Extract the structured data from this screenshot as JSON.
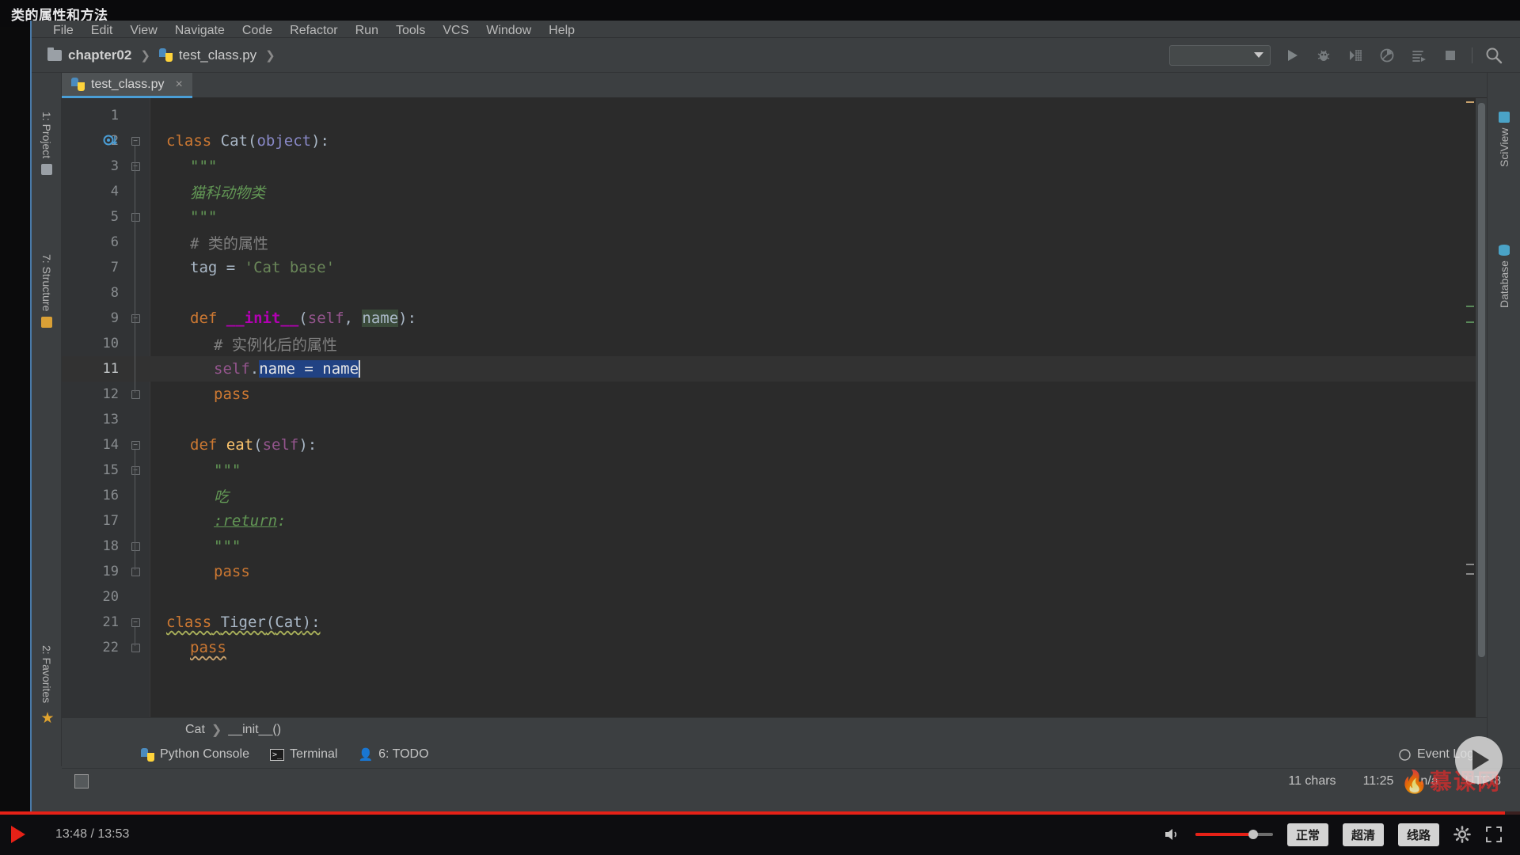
{
  "video": {
    "title": "类的属性和方法",
    "current_time": "13:48",
    "total_time": "13:53",
    "time_display": "13:48 / 13:53",
    "quality_label": "超清",
    "speed_label": "正常",
    "route_label": "线路",
    "progress_percent": 99,
    "volume_percent": 75,
    "accent_color": "#e62117"
  },
  "ide": {
    "menu": [
      "File",
      "Edit",
      "View",
      "Navigate",
      "Code",
      "Refactor",
      "Run",
      "Tools",
      "VCS",
      "Window",
      "Help"
    ],
    "breadcrumb": [
      {
        "label": "chapter02",
        "icon": "folder-icon"
      },
      {
        "label": "test_class.py",
        "icon": "python-file-icon"
      }
    ],
    "toolbar_icons": [
      "run-configuration-dropdown",
      "run-icon",
      "debug-icon",
      "coverage-icon",
      "profile-icon",
      "run-with-console-icon",
      "stop-icon",
      "search-everywhere-icon"
    ],
    "editor_tab": {
      "label": "test_class.py",
      "close": "×"
    },
    "left_strip": [
      {
        "label": "1: Project",
        "icon": "project-icon"
      },
      {
        "label": "7: Structure",
        "icon": "structure-icon"
      },
      {
        "label": "2: Favorites",
        "icon": "favorites-star-icon"
      }
    ],
    "right_strip": [
      {
        "label": "SciView",
        "icon": "sciview-grid-icon"
      },
      {
        "label": "Database",
        "icon": "database-icon"
      }
    ],
    "bottom_breadcrumb": [
      "Cat",
      "__init__()"
    ],
    "bottom_tools": [
      {
        "label": "Python Console",
        "icon": "python-console-icon"
      },
      {
        "label": "Terminal",
        "icon": "terminal-icon"
      },
      {
        "label": "6: TODO",
        "icon": "todo-icon"
      }
    ],
    "event_log": "Event Log",
    "status": {
      "chars": "11 chars",
      "caret_position": "11:25",
      "line_separator": "n/a",
      "encoding": "UTF-8"
    },
    "watermark": "慕课网"
  },
  "code": {
    "language": "python",
    "cursor_line": 11,
    "selection_text": "name = name",
    "lines": [
      {
        "n": 1,
        "indent": 0,
        "tokens": []
      },
      {
        "n": 2,
        "indent": 0,
        "fold": "minus",
        "gutter": "run-class-icon",
        "tokens": [
          {
            "t": "class",
            "c": "kw"
          },
          {
            "t": " ",
            "c": "plain"
          },
          {
            "t": "Cat",
            "c": "cls"
          },
          {
            "t": "(",
            "c": "plain"
          },
          {
            "t": "object",
            "c": "bi"
          },
          {
            "t": "):",
            "c": "plain"
          }
        ]
      },
      {
        "n": 3,
        "indent": 1,
        "fold": "minus",
        "tokens": [
          {
            "t": "\"\"\"",
            "c": "doc"
          }
        ]
      },
      {
        "n": 4,
        "indent": 1,
        "tokens": [
          {
            "t": "猫科动物类",
            "c": "doc"
          }
        ]
      },
      {
        "n": 5,
        "indent": 1,
        "fold": "end",
        "tokens": [
          {
            "t": "\"\"\"",
            "c": "doc"
          }
        ]
      },
      {
        "n": 6,
        "indent": 1,
        "tokens": [
          {
            "t": "# 类的属性",
            "c": "cmt"
          }
        ]
      },
      {
        "n": 7,
        "indent": 1,
        "tokens": [
          {
            "t": "tag",
            "c": "plain"
          },
          {
            "t": " = ",
            "c": "plain"
          },
          {
            "t": "'Cat base'",
            "c": "str"
          }
        ]
      },
      {
        "n": 8,
        "indent": 0,
        "tokens": []
      },
      {
        "n": 9,
        "indent": 1,
        "fold": "minus",
        "tokens": [
          {
            "t": "def",
            "c": "kw"
          },
          {
            "t": " ",
            "c": "plain"
          },
          {
            "t": "__init__",
            "c": "dunder"
          },
          {
            "t": "(",
            "c": "plain"
          },
          {
            "t": "self",
            "c": "self"
          },
          {
            "t": ", ",
            "c": "plain"
          },
          {
            "t": "name",
            "c": "param-hl"
          },
          {
            "t": "):",
            "c": "plain"
          }
        ]
      },
      {
        "n": 10,
        "indent": 2,
        "tokens": [
          {
            "t": "# 实例化后的属性",
            "c": "cmt"
          }
        ]
      },
      {
        "n": 11,
        "indent": 2,
        "current": true,
        "tokens": [
          {
            "t": "self",
            "c": "self"
          },
          {
            "t": ".",
            "c": "plain"
          },
          {
            "t": "name = name",
            "c": "sel"
          }
        ]
      },
      {
        "n": 12,
        "indent": 2,
        "fold": "end",
        "tokens": [
          {
            "t": "pass",
            "c": "kw"
          }
        ]
      },
      {
        "n": 13,
        "indent": 0,
        "tokens": []
      },
      {
        "n": 14,
        "indent": 1,
        "fold": "minus",
        "tokens": [
          {
            "t": "def",
            "c": "kw"
          },
          {
            "t": " ",
            "c": "plain"
          },
          {
            "t": "eat",
            "c": "fn"
          },
          {
            "t": "(",
            "c": "plain"
          },
          {
            "t": "self",
            "c": "self"
          },
          {
            "t": "):",
            "c": "plain"
          }
        ]
      },
      {
        "n": 15,
        "indent": 2,
        "fold": "minus",
        "tokens": [
          {
            "t": "\"\"\"",
            "c": "doc"
          }
        ]
      },
      {
        "n": 16,
        "indent": 2,
        "tokens": [
          {
            "t": "吃",
            "c": "doc"
          }
        ]
      },
      {
        "n": 17,
        "indent": 2,
        "tokens": [
          {
            "t": ":return",
            "c": "doctag"
          },
          {
            "t": ":",
            "c": "doc"
          }
        ]
      },
      {
        "n": 18,
        "indent": 2,
        "fold": "end",
        "tokens": [
          {
            "t": "\"\"\"",
            "c": "doc"
          }
        ]
      },
      {
        "n": 19,
        "indent": 2,
        "fold": "end",
        "tokens": [
          {
            "t": "pass",
            "c": "kw"
          }
        ]
      },
      {
        "n": 20,
        "indent": 0,
        "tokens": []
      },
      {
        "n": 21,
        "indent": 0,
        "fold": "minus",
        "tokens": [
          {
            "t": "class",
            "c": "kw squig"
          },
          {
            "t": " ",
            "c": "plain squig"
          },
          {
            "t": "Tiger",
            "c": "cls squig"
          },
          {
            "t": "(",
            "c": "plain squig"
          },
          {
            "t": "Cat",
            "c": "cls squig"
          },
          {
            "t": "):",
            "c": "plain squig"
          }
        ]
      },
      {
        "n": 22,
        "indent": 1,
        "fold": "end",
        "tokens": [
          {
            "t": "pass",
            "c": "kw squig2"
          }
        ]
      }
    ]
  }
}
